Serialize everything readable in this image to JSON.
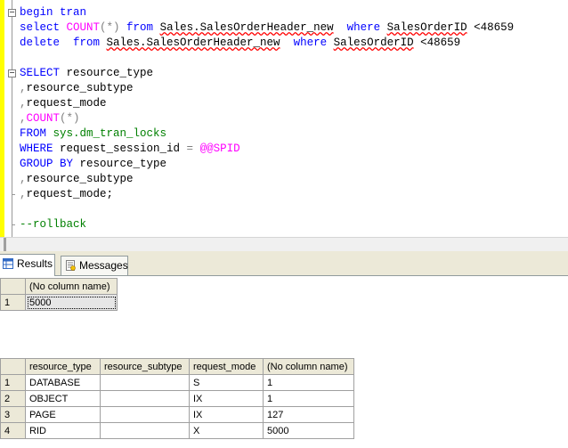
{
  "editor": {
    "lines": [
      {
        "parts": [
          {
            "t": "begin tran",
            "c": "kw"
          }
        ]
      },
      {
        "parts": [
          {
            "t": "select ",
            "c": "kw"
          },
          {
            "t": "COUNT",
            "c": "fn"
          },
          {
            "t": "(*)",
            "c": "gray"
          },
          {
            "t": " from ",
            "c": "kw"
          },
          {
            "t": "Sales.SalesOrderHeader_new",
            "c": "obj"
          },
          {
            "t": "  where ",
            "c": "kw"
          },
          {
            "t": "SalesOrderID",
            "c": "obj"
          },
          {
            "t": " <48659",
            "c": ""
          }
        ]
      },
      {
        "parts": [
          {
            "t": "delete  from ",
            "c": "kw"
          },
          {
            "t": "Sales.SalesOrderHeader_new",
            "c": "obj"
          },
          {
            "t": "  where ",
            "c": "kw"
          },
          {
            "t": "SalesOrderID",
            "c": "obj"
          },
          {
            "t": " <48659",
            "c": ""
          }
        ]
      },
      {
        "parts": []
      },
      {
        "parts": [
          {
            "t": "SELECT ",
            "c": "kw"
          },
          {
            "t": "resource_type",
            "c": ""
          }
        ]
      },
      {
        "parts": [
          {
            "t": ",",
            "c": "gray"
          },
          {
            "t": "resource_subtype",
            "c": ""
          }
        ]
      },
      {
        "parts": [
          {
            "t": ",",
            "c": "gray"
          },
          {
            "t": "request_mode",
            "c": ""
          }
        ]
      },
      {
        "parts": [
          {
            "t": ",",
            "c": "gray"
          },
          {
            "t": "COUNT",
            "c": "fn"
          },
          {
            "t": "(*)",
            "c": "gray"
          }
        ]
      },
      {
        "parts": [
          {
            "t": "FROM ",
            "c": "kw"
          },
          {
            "t": "sys.dm_tran_locks",
            "c": "green"
          }
        ]
      },
      {
        "parts": [
          {
            "t": "WHERE ",
            "c": "kw"
          },
          {
            "t": "request_session_id ",
            "c": ""
          },
          {
            "t": "=",
            "c": "gray"
          },
          {
            "t": " @@SPID",
            "c": "fn"
          }
        ]
      },
      {
        "parts": [
          {
            "t": "GROUP BY ",
            "c": "kw"
          },
          {
            "t": "resource_type",
            "c": ""
          }
        ]
      },
      {
        "parts": [
          {
            "t": ",",
            "c": "gray"
          },
          {
            "t": "resource_subtype",
            "c": ""
          }
        ]
      },
      {
        "parts": [
          {
            "t": ",",
            "c": "gray"
          },
          {
            "t": "request_mode;",
            "c": ""
          }
        ]
      },
      {
        "parts": []
      },
      {
        "parts": [
          {
            "t": "--rollback",
            "c": "green"
          }
        ]
      }
    ]
  },
  "tabs": {
    "results_label": "Results",
    "messages_label": "Messages"
  },
  "grid1": {
    "headers": [
      "(No column name)"
    ],
    "rows": [
      {
        "num": "1",
        "cells": [
          "5000"
        ]
      }
    ]
  },
  "grid2": {
    "headers": [
      "resource_type",
      "resource_subtype",
      "request_mode",
      "(No column name)"
    ],
    "rows": [
      {
        "num": "1",
        "cells": [
          "DATABASE",
          "",
          "S",
          "1"
        ]
      },
      {
        "num": "2",
        "cells": [
          "OBJECT",
          "",
          "IX",
          "1"
        ]
      },
      {
        "num": "3",
        "cells": [
          "PAGE",
          "",
          "IX",
          "127"
        ]
      },
      {
        "num": "4",
        "cells": [
          "RID",
          "",
          "X",
          "5000"
        ]
      }
    ]
  }
}
